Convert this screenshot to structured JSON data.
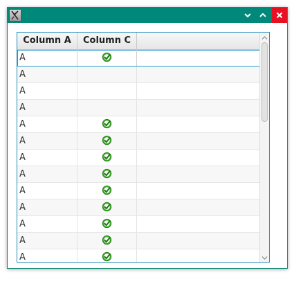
{
  "window": {
    "title_buttons": [
      "minimize",
      "maximize",
      "close"
    ],
    "close_color": "#e81123",
    "accent": "#00897b"
  },
  "table": {
    "columns": [
      "Column A",
      "Column C",
      ""
    ],
    "rows": [
      {
        "a": "A",
        "c_checked": true
      },
      {
        "a": "A",
        "c_checked": false
      },
      {
        "a": "A",
        "c_checked": false
      },
      {
        "a": "A",
        "c_checked": false
      },
      {
        "a": "A",
        "c_checked": true
      },
      {
        "a": "A",
        "c_checked": true
      },
      {
        "a": "A",
        "c_checked": true
      },
      {
        "a": "A",
        "c_checked": true
      },
      {
        "a": "A",
        "c_checked": true
      },
      {
        "a": "A",
        "c_checked": true
      },
      {
        "a": "A",
        "c_checked": true
      },
      {
        "a": "A",
        "c_checked": true
      },
      {
        "a": "A",
        "c_checked": true
      }
    ],
    "selected_row": 0
  },
  "icons": {
    "app": "app-window-icon",
    "check": "green-check-icon",
    "minimize": "chevron-down-icon",
    "maximize": "chevron-up-icon",
    "close": "close-icon"
  }
}
